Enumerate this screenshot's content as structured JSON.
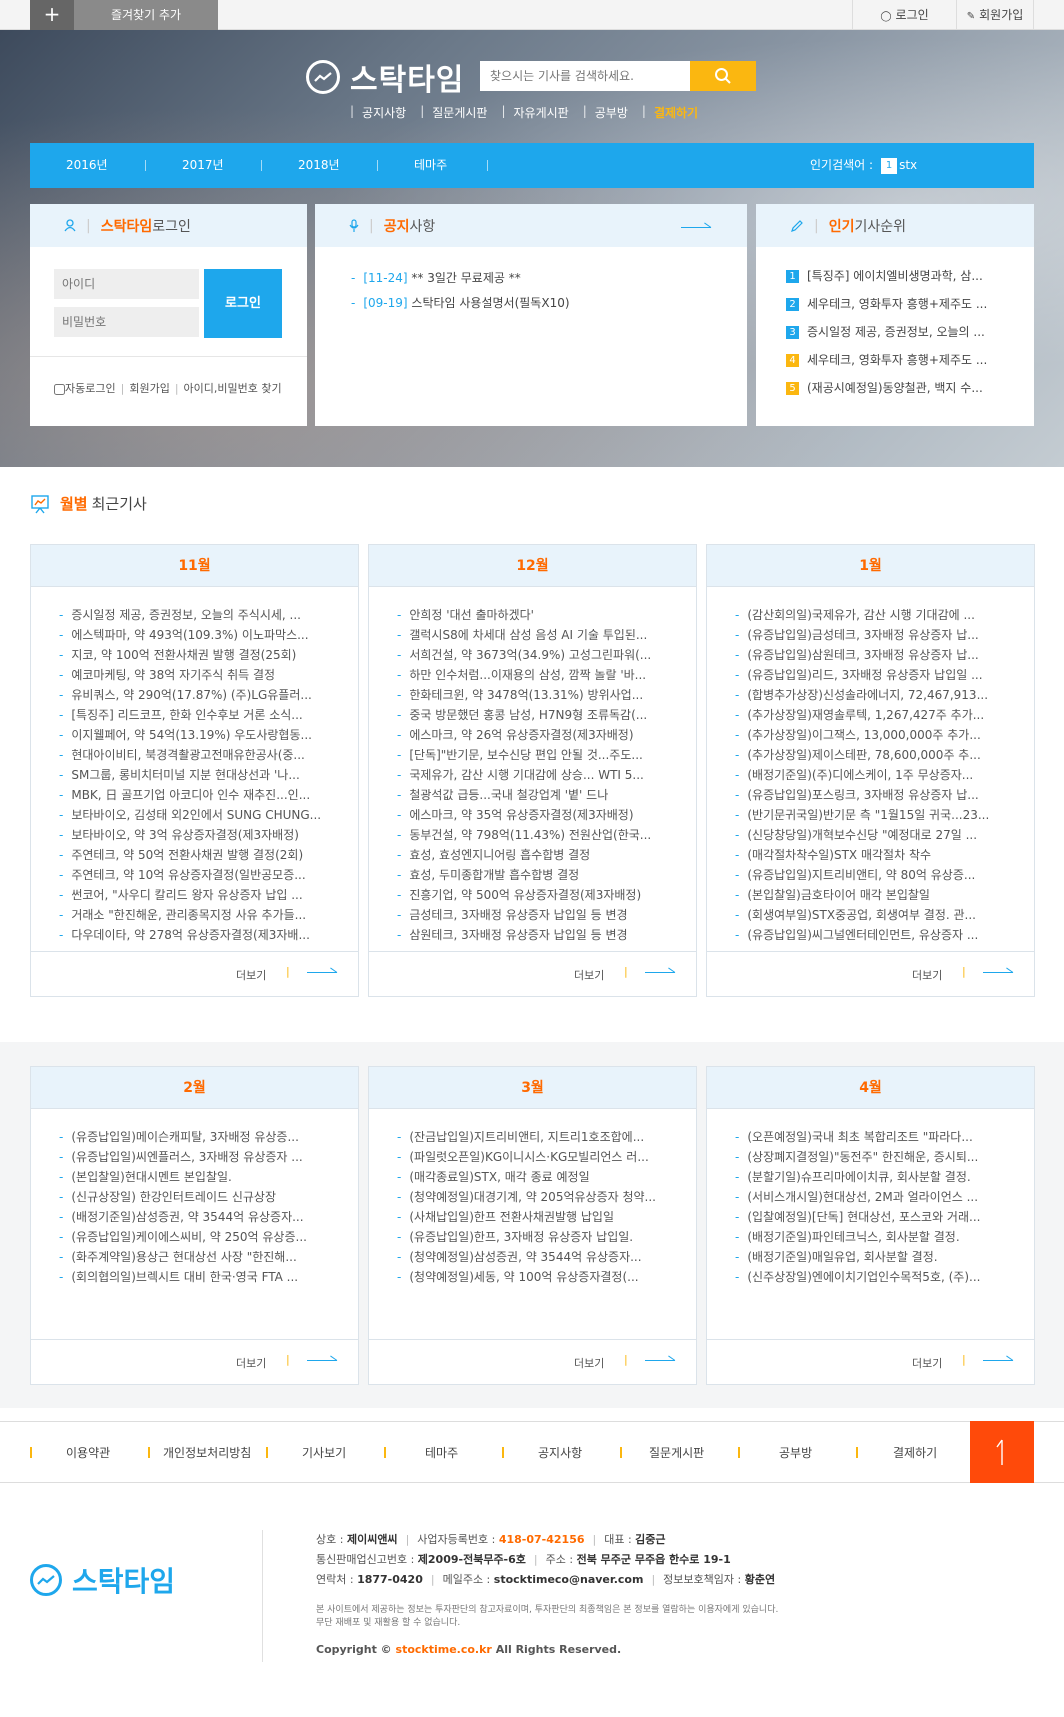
{
  "topbar": {
    "plus": "+",
    "favorite": "즐겨찾기 추가",
    "login": "로그인",
    "join": "회원가입"
  },
  "brand": {
    "name": "스탁타임"
  },
  "search": {
    "placeholder": "찾으시는 기사를 검색하세요."
  },
  "mainnav": [
    "공지사항",
    "질문게시판",
    "자유게시판",
    "공부방",
    "결제하기"
  ],
  "yearbar": {
    "items": [
      "2016년",
      "2017년",
      "2018년",
      "테마주"
    ],
    "popular_label": "인기검색어 :",
    "popular_rank": "1",
    "popular_term": "stx"
  },
  "login_panel": {
    "title_em": "스탁타임",
    "title": " 로그인",
    "id_placeholder": "아이디",
    "pw_placeholder": "비밀번호",
    "button": "로그인",
    "auto": "자동로그인",
    "join": "회원가입",
    "find": "아이디,비밀번호 찾기"
  },
  "notice_panel": {
    "title_em": "공지",
    "title": "사항",
    "items": [
      {
        "date": "[11-24]",
        "text": "** 3일간 무료제공 **"
      },
      {
        "date": "[09-19]",
        "text": "스탁타임 사용설명서(필독X10)"
      }
    ]
  },
  "rank_panel": {
    "title_em": "인기",
    "title": " 기사순위",
    "items": [
      {
        "n": "1",
        "color": "#1ea7ec",
        "text": "[특징주] 에이치엘비생명과학, 삼..."
      },
      {
        "n": "2",
        "color": "#1ea7ec",
        "text": "세우테크, 영화투자 흥행+제주도 ..."
      },
      {
        "n": "3",
        "color": "#1ea7ec",
        "text": "증시일정 제공, 증권정보, 오늘의 ..."
      },
      {
        "n": "4",
        "color": "#fbb710",
        "text": "세우테크, 영화투자 흥행+제주도 ..."
      },
      {
        "n": "5",
        "color": "#fbb710",
        "text": "(재공시예정일)동양철관, 백지 수..."
      }
    ]
  },
  "monthly": {
    "title_em": "월별",
    "title": "최근기사",
    "more": "더보기",
    "bar": "|",
    "cards": [
      {
        "month": "11월",
        "items": [
          "증시일정 제공, 증권정보, 오늘의 주식시세, ...",
          "에스텍파마, 약 493억(109.3%) 이노파막스...",
          "지코, 약 100억 전환사채권 발행 결정(25회)",
          "예코마케팅, 약 38억 자기주식 취득 결정",
          "유비쿼스, 약 290억(17.87%) (주)LG유플러...",
          "[특징주] 리드코프, 한화 인수후보 거론 소식...",
          "이지웰페어, 약 54억(13.19%) 우도사랑협동...",
          "현대아이비티, 북경격촬광고전매유한공사(중...",
          "SM그룹, 롱비치터미널 지분 현대상선과 '나...",
          "MBK, 日 골프기업 아코디아 인수 재추진...인...",
          "보타바이오, 김성태 외2인에서 SUNG CHUNG...",
          "보타바이오, 약 3억 유상증자결정(제3자배정)",
          "주연테크, 약 50억 전환사채권 발행 결정(2회)",
          "주연테크, 약 10억 유상증자결정(일반공모증...",
          "썬코어, \"사우디 칼리드 왕자 유상증자 납입 ...",
          "거래소 \"한진해운, 관리종목지정 사유 추가들...",
          "다우데이타, 약 278억 유상증자결정(제3자배..."
        ]
      },
      {
        "month": "12월",
        "items": [
          "안희정 '대선 출마하겠다'",
          "갤럭시S8에 차세대 삼성 음성 AI 기술 투입된...",
          "서희건설, 약 3673억(34.9%) 고성그린파워(...",
          "하만 인수처럼...이재용의 삼성, 깜짝 놀랄 '바...",
          "한화테크윈, 약 3478억(13.31%) 방위사업...",
          "중국 방문했던 홍콩 남성, H7N9형 조류독감(...",
          "에스마크, 약 26억 유상증자결정(제3자배정)",
          "[단독]\"반기문, 보수신당 편입 안될 것...주도...",
          "국제유가, 감산 시행 기대감에 상승... WTI 5...",
          "철광석값 급등...국내 철강업계 '볕' 드나",
          "에스마크, 약 35억 유상증자결정(제3자배정)",
          "동부건설, 약 798억(11.43%) 전원산업(한국...",
          "효성, 효성엔지니어링 흡수합병 결정",
          "효성, 두미종합개발 흡수합병 결정",
          "진흥기업, 약 500억 유상증자결정(제3자배정)",
          "금성테크, 3자배정 유상증자 납입일 등 변경",
          "삼원테크, 3자배정 유상증자 납입일 등 변경"
        ]
      },
      {
        "month": "1월",
        "items": [
          "(감산회의일)국제유가, 감산 시행 기대감에 ...",
          "(유증납입일)금성테크, 3자배정 유상증자 납...",
          "(유증납입일)삼원테크, 3자배정 유상증자 납...",
          "(유증납입일)리드, 3자배정 유상증자 납입일 ...",
          "(합병추가상장)신성솔라에너지, 72,467,913...",
          "(추가상장일)재영솔루텍, 1,267,427주 추가...",
          "(추가상장일)이그잭스, 13,000,000주 추가...",
          "(추가상장일)제이스테판, 78,600,000주 추...",
          "(배정기준일)(주)디에스케이, 1주 무상증자...",
          "(유증납입일)포스링크, 3자배정 유상증자 납...",
          "(반기문귀국일)반기문 측 \"1월15일 귀국...23...",
          "(신당창당일)개혁보수신당 \"예정대로 27일 ...",
          "(매각절차착수일)STX 매각절차 착수",
          "(유증납입일)지트리비앤티, 약 80억 유상증...",
          "(본입찰일)금호타이어 매각 본입찰일",
          "(회생여부일)STX중공업, 회생여부 결정. 관...",
          "(유증납입일)씨그널엔터테인먼트, 유상증자 ..."
        ]
      },
      {
        "month": "2월",
        "items": [
          "(유증납입일)메이슨캐피탈, 3자배정 유상증...",
          "(유증납입일)씨엔플러스, 3자배정 유상증자 ...",
          "(본입찰일)현대시멘트 본입찰일.",
          "(신규상장일) 한강인터트레이드 신규상장",
          "(배정기준일)삼성증권, 약 3544억 유상증자...",
          "(유증납입일)케이에스씨비, 약 250억 유상증...",
          "(화주계약일)용상근 현대상선 사장 \"한진해...",
          "(회의협의일)브렉시트 대비 한국·영국 FTA ..."
        ]
      },
      {
        "month": "3월",
        "items": [
          "(잔금납입일)지트리비앤티, 지트리1호조합에...",
          "(파일럿오픈일)KG이니시스·KG모빌리언스 러...",
          "(매각종료일)STX, 매각 종료 예정일",
          "(청약예정일)대경기계, 약 205억유상증자 청약...",
          "(사채납입일)한프 전환사채권발행 납입일",
          "(유증납입일)한프, 3자배정 유상증자 납입일.",
          "(청약예정일)삼성증권, 약 3544억 유상증자...",
          "(청약예정일)세동, 약 100억 유상증자결정(..."
        ]
      },
      {
        "month": "4월",
        "items": [
          "(오픈예정일)국내 최초 복합리조트 \"파라다...",
          "(상장폐지결정일)\"동전주\" 한진해운, 증시퇴...",
          "(분할기일)슈프리마에이치큐, 회사분할 결정.",
          "(서비스개시일)현대상선, 2M과 얼라이언스 ...",
          "(입찰예정일)[단독] 현대상선, 포스코와 거래...",
          "(배정기준일)파인테크닉스, 회사분할 결정.",
          "(배정기준일)매일유업, 회사분할 결정.",
          "(신주상장일)엔에이치기업인수목적5호, (주)..."
        ]
      }
    ]
  },
  "footer_nav": [
    "이용약관",
    "개인정보처리방침",
    "기사보기",
    "테마주",
    "공지사항",
    "질문게시판",
    "공부방",
    "결제하기"
  ],
  "footer": {
    "logo": "스탁타임",
    "line1": [
      {
        "k": "상호 : ",
        "v": "제이씨앤씨"
      },
      {
        "k": "사업자등록번호 : ",
        "v": "418-07-42156",
        "or": true
      },
      {
        "k": "대표 : ",
        "v": "김중근"
      }
    ],
    "line2": [
      {
        "k": "통신판매업신고번호 : ",
        "v": "제2009-전북무주-6호"
      },
      {
        "k": "주소 : ",
        "v": "전북 무주군 무주읍 한수로 19-1"
      }
    ],
    "line3": [
      {
        "k": "연락처 : ",
        "v": "1877-0420"
      },
      {
        "k": "메일주소 : ",
        "v": "stocktimeco@naver.com"
      },
      {
        "k": "정보보호책임자 : ",
        "v": "황춘연"
      }
    ],
    "disclaimer1": "본 사이트에서 제공하는 정보는 투자판단의 참고자료이며, 투자판단의 최종책임은 본 정보를 열람하는 이용자에게 있습니다.",
    "disclaimer2": "무단 재배포 및 재활용 할 수 없습니다.",
    "copy_pre": "Copyright ©",
    "copy_site": "stocktime.co.kr",
    "copy_post": "All Rights Reserved."
  },
  "icons": {
    "accent": "#1ea7ec",
    "orange": "#ff6a00",
    "yellow": "#fbb710"
  }
}
